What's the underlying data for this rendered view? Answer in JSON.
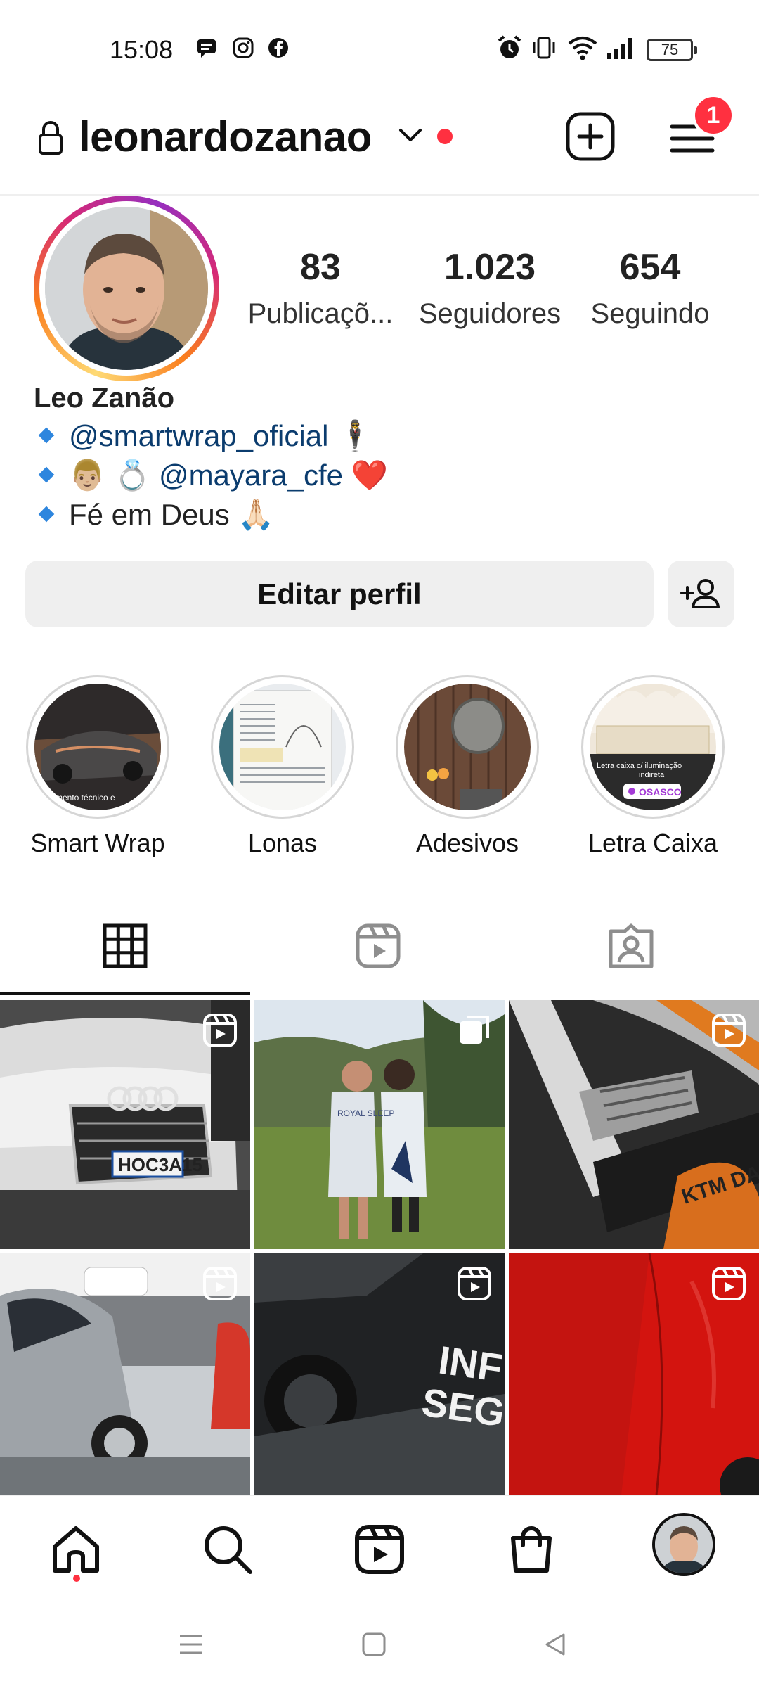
{
  "status_bar": {
    "time": "15:08",
    "battery": "75"
  },
  "header": {
    "username": "leonardozanao",
    "notification_count": "1"
  },
  "profile": {
    "stats": [
      {
        "value": "83",
        "label": "Publicaçõ..."
      },
      {
        "value": "1.023",
        "label": "Seguidores"
      },
      {
        "value": "654",
        "label": "Seguindo"
      }
    ],
    "full_name": "Leo Zanão",
    "bio": [
      {
        "text": "@smartwrap_oficial",
        "emoji": "🕴"
      },
      {
        "prefix_emoji": "👨🏼 💍",
        "text": "@mayara_cfe",
        "emoji": "❤️"
      },
      {
        "text": "Fé em Deus",
        "emoji": "🙏🏻"
      }
    ],
    "edit_button": "Editar perfil"
  },
  "highlights": [
    {
      "label": "Smart Wrap"
    },
    {
      "label": "Lonas"
    },
    {
      "label": "Adesivos"
    },
    {
      "label": "Letra Caixa"
    }
  ],
  "highlight_overlay_text": {
    "smart_wrap": "mento técnico e",
    "letra_caixa_line1": "Letra caixa c/ iluminação",
    "letra_caixa_line2": "indireta",
    "letra_caixa_location": "OSASCO"
  },
  "tabs": [
    {
      "name": "grid-icon",
      "active": true
    },
    {
      "name": "reels-icon",
      "active": false
    },
    {
      "name": "tagged-icon",
      "active": false
    }
  ],
  "posts": [
    {
      "type": "reel",
      "plate_text": "HOC3A15"
    },
    {
      "type": "carousel",
      "shirt_text": "ROYAL SLEEP"
    },
    {
      "type": "reel",
      "brand_text": "KTM DA"
    },
    {
      "type": "reel"
    },
    {
      "type": "reel",
      "door_text_line1": "INF",
      "door_text_line2": "SEGU"
    },
    {
      "type": "reel"
    }
  ],
  "bottom_nav": [
    {
      "name": "home-icon"
    },
    {
      "name": "search-icon"
    },
    {
      "name": "reels-icon"
    },
    {
      "name": "shop-icon"
    },
    {
      "name": "profile-avatar"
    }
  ],
  "colors": {
    "accent_red": "#ff3040",
    "mention_blue": "#0b3c6e",
    "button_gray": "#efefef"
  }
}
